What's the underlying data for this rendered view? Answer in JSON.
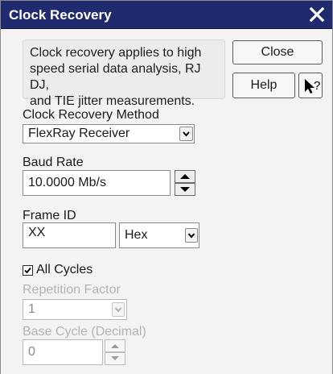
{
  "window": {
    "title": "Clock Recovery"
  },
  "info_text": [
    "Clock recovery applies to high",
    "speed serial data analysis, RJ DJ,",
    "and TIE jitter measurements."
  ],
  "buttons": {
    "close": "Close",
    "help": "Help",
    "whats_this": "?"
  },
  "method": {
    "label": "Clock Recovery Method",
    "value": "FlexRay Receiver"
  },
  "baud": {
    "label": "Baud Rate",
    "value": "10.0000 Mb/s"
  },
  "frame": {
    "label": "Frame ID",
    "value": "XX",
    "format": "Hex"
  },
  "all_cycles": {
    "label": "All Cycles",
    "checked": true
  },
  "repetition": {
    "label": "Repetition Factor",
    "value": "1",
    "enabled": false
  },
  "base_cycle": {
    "label": "Base Cycle (Decimal)",
    "value": "0",
    "enabled": false
  },
  "colors": {
    "titlebar": "#1f2b6e",
    "background": "#f3f3f3",
    "disabled_text": "#b3b3b3"
  },
  "icons": [
    "close-icon",
    "chevron-down-icon",
    "spin-up-icon",
    "spin-down-icon",
    "whats-this-pointer-icon",
    "checkmark-icon"
  ]
}
